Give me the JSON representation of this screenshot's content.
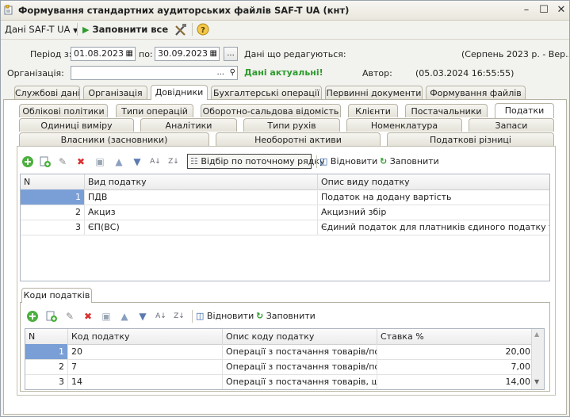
{
  "window": {
    "title": "Формування стандартних аудиторських файлів SAF-T UA (кнт)"
  },
  "toolbar": {
    "data_menu": "Дані SAF-T UA",
    "fill_all": "Заповнити все"
  },
  "filters": {
    "period_label": "Період з:",
    "date_from": "01.08.2023",
    "to_label": "по:",
    "date_to": "30.09.2023",
    "ellipsis": "...",
    "editing_label": "Дані що редагуються:",
    "editing_value": "(Серпень 2023 р. - Вер...",
    "org_label": "Організація:",
    "org_value": "",
    "actual_label": "Дані актуальні!",
    "author_label": "Автор:",
    "author_value": "(05.03.2024 16:55:55)"
  },
  "main_tabs": [
    "Службові дані",
    "Організація",
    "Довідники",
    "Бухгалтерські операції",
    "Первинні документи",
    "Формування файлів"
  ],
  "sub_tabs_row1": [
    "Облікові політики",
    "Типи операцій",
    "Оборотно-сальдова відомість",
    "Клієнти",
    "Постачальники",
    "Податки"
  ],
  "sub_tabs_row2": [
    "Одиниці виміру",
    "Аналітики",
    "Типи рухів",
    "Номенклатура",
    "Запаси"
  ],
  "sub_tabs_row3": [
    "Власники (засновники)",
    "Необоротні активи",
    "Податкові різниці"
  ],
  "grid1": {
    "filter_btn": "Відбір по поточному рядку",
    "restore_btn": "Відновити",
    "fill_btn": "Заповнити",
    "headers": [
      "N",
      "Вид податку",
      "Опис виду податку"
    ],
    "rows": [
      {
        "n": "1",
        "kind": "ПДВ",
        "desc": "Податок на додану вартість"
      },
      {
        "n": "2",
        "kind": "Акциз",
        "desc": "Акцизний збір"
      },
      {
        "n": "3",
        "kind": "ЄП(ВС)",
        "desc": "Єдиний податок для платників єдиного податку треть..."
      }
    ]
  },
  "codes_panel": {
    "tab": "Коди податків",
    "restore_btn": "Відновити",
    "fill_btn": "Заповнити",
    "headers": [
      "N",
      "Код податку",
      "Опис коду податку",
      "Ставка %"
    ],
    "rows": [
      {
        "n": "1",
        "code": "20",
        "desc": "Операції з постачання товарів/пос...",
        "rate": "20,00"
      },
      {
        "n": "2",
        "code": "7",
        "desc": "Операції з постачання товарів/пос...",
        "rate": "7,00"
      },
      {
        "n": "3",
        "code": "14",
        "desc": "Операції з постачання товарів, що ...",
        "rate": "14,00"
      }
    ]
  },
  "colors": {
    "accent_green": "#2e9b2e",
    "selection": "#7a9fd6"
  }
}
